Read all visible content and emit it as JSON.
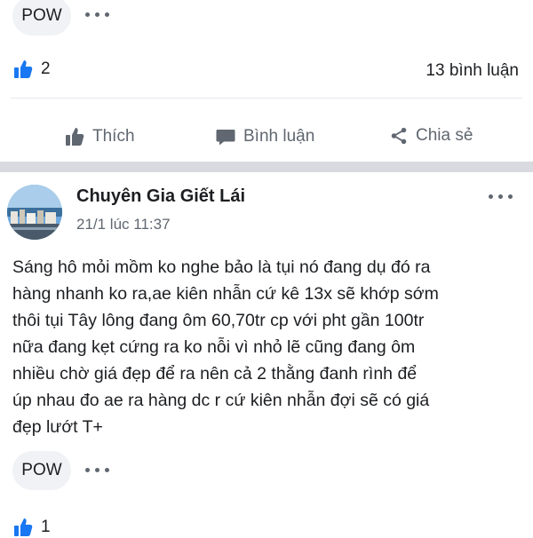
{
  "top_post": {
    "reaction_label": "POW",
    "like_count": "2",
    "comment_count": "13 bình luận",
    "actions": {
      "like": "Thích",
      "comment": "Bình luận",
      "share": "Chia sẻ"
    }
  },
  "post": {
    "author": "Chuyên Gia Giết Lái",
    "timestamp": "21/1 lúc 11:37",
    "text": "Sáng hô mỏi mồm ko nghe bảo là tụi nó đang dụ đó ra\nhàng nhanh ko ra,ae kiên nhẫn cứ kê 13x sẽ khớp sớm\nthôi tụi Tây lông đang ôm 60,70tr cp với pht gần 100tr\nnữa đang kẹt cứng ra ko nỗi vì nhỏ lẽ cũng đang ôm\nnhiều chờ giá đẹp để ra nên cả 2 thằng đanh rình để\núp nhau đo ae ra hàng dc r cứ kiên nhẫn đợi sẽ có giá\nđẹp lướt T+",
    "reaction_label": "POW",
    "like_count": "1"
  },
  "colors": {
    "like_blue": "#1877f2",
    "muted": "#606770",
    "pill_bg": "#f0f2f5",
    "separator": "#d8dadf"
  }
}
